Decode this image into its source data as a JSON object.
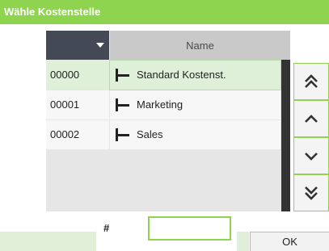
{
  "window": {
    "title": "Wähle Kostenstelle"
  },
  "table": {
    "sort_label": "",
    "name_header": "Name",
    "rows": [
      {
        "code": "00000",
        "name": "Standard Kostenst.",
        "selected": true
      },
      {
        "code": "00001",
        "name": "Marketing",
        "selected": false
      },
      {
        "code": "00002",
        "name": "Sales",
        "selected": false
      }
    ]
  },
  "nav": {
    "icons": [
      "double-up-icon",
      "up-icon",
      "down-icon",
      "double-down-icon"
    ]
  },
  "footer": {
    "hash_label": "#",
    "hash_value": "",
    "ok_label": "OK"
  },
  "colors": {
    "accent": "#8fd44f",
    "header_dark": "#444a55",
    "selected_row": "#dff0d8"
  }
}
